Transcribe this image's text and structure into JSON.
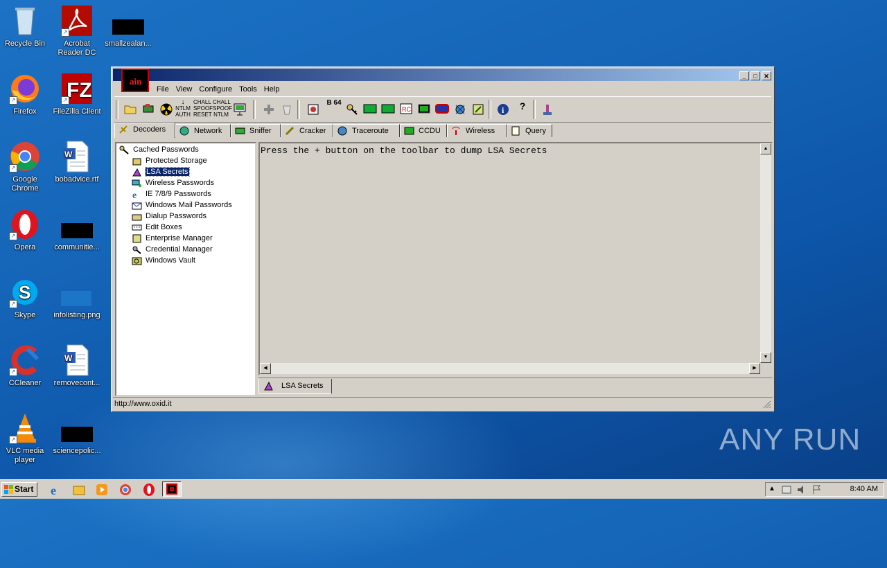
{
  "desktop": {
    "icons": [
      {
        "label": "Recycle Bin"
      },
      {
        "label": "Acrobat Reader DC"
      },
      {
        "label": "smallzealan..."
      },
      {
        "label": "Firefox"
      },
      {
        "label": "FileZilla Client"
      },
      {
        "label": "Google Chrome"
      },
      {
        "label": "bobadvice.rtf"
      },
      {
        "label": "Opera"
      },
      {
        "label": "communitie..."
      },
      {
        "label": "Skype"
      },
      {
        "label": "infolisting.png"
      },
      {
        "label": "CCleaner"
      },
      {
        "label": "removecont..."
      },
      {
        "label": "VLC media player"
      },
      {
        "label": "sciencepolic..."
      }
    ]
  },
  "window": {
    "menu": [
      "File",
      "View",
      "Configure",
      "Tools",
      "Help"
    ],
    "logo_text": "ain",
    "tabs": [
      "Decoders",
      "Network",
      "Sniffer",
      "Cracker",
      "Traceroute",
      "CCDU",
      "Wireless",
      "Query"
    ],
    "active_tab": "Decoders",
    "tree": {
      "root": "Cached Passwords",
      "items": [
        "Protected Storage",
        "LSA Secrets",
        "Wireless Passwords",
        "IE 7/8/9 Passwords",
        "Windows Mail Passwords",
        "Dialup Passwords",
        "Edit Boxes",
        "Enterprise Manager",
        "Credential Manager",
        "Windows Vault"
      ],
      "selected": "LSA Secrets"
    },
    "content_message": "Press the + button on the toolbar to dump LSA Secrets",
    "subtab": "LSA Secrets",
    "status": "http://www.oxid.it",
    "toolbar_labels": {
      "ntlm_auth": "NTLM AUTH",
      "chall_spoof_reset": "CHALL SPOOF RESET",
      "chall_spoof_ntlm": "CHALL SPOOF NTLM",
      "b64": "B 64"
    }
  },
  "taskbar": {
    "start": "Start",
    "clock": "8:40 AM"
  },
  "watermark": "ANY RUN",
  "colors": {
    "titlebar_start": "#0a246a",
    "titlebar_end": "#a6caf0",
    "selection": "#0a246a"
  }
}
